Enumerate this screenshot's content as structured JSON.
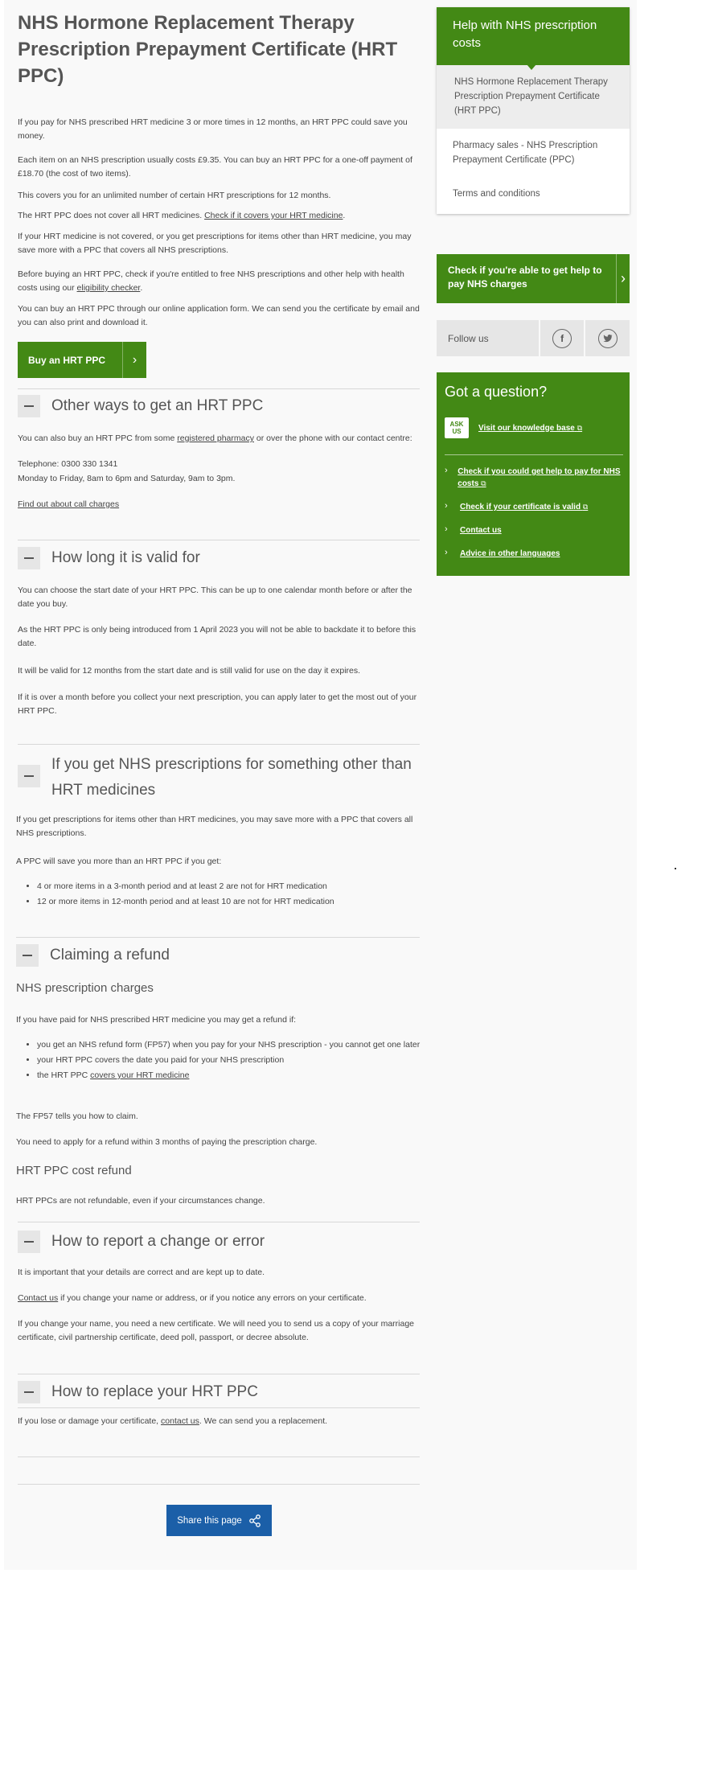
{
  "title": "NHS Hormone Replacement Therapy Prescription Prepayment Certificate (HRT PPC)",
  "intro": [
    "If you pay for NHS prescribed HRT medicine 3 or more times in 12 months, an HRT PPC could save you money.",
    "Each item on an NHS prescription usually costs £9.35. You can buy an HRT PPC for a one-off payment of £18.70 (the cost of two items).",
    "This covers you for an unlimited number of certain HRT prescriptions for 12 months."
  ],
  "covers": {
    "pre": "The HRT PPC does not cover all HRT medicines. ",
    "link": "Check if it covers your HRT medicine",
    "post": "."
  },
  "not_covered": "If your HRT medicine is not covered, or you get prescriptions for items other than HRT medicine, you may save more with a PPC that covers all NHS prescriptions.",
  "before_buying": {
    "pre": "Before buying an HRT PPC, check if you're entitled to free NHS prescriptions and other help with health costs using our ",
    "link": "eligibility checker",
    "post": "."
  },
  "online": "You can buy an HRT PPC through our online application form. We can send you the certificate by email and you can also print and download it.",
  "buy_button": "Buy an HRT PPC",
  "chevron": "›",
  "other_ways": {
    "title": "Other ways to get an HRT PPC",
    "text_pre": "You can also buy an HRT PPC from some ",
    "text_link": "registered pharmacy",
    "text_post": " or over the phone with our contact centre:",
    "telephone": "Telephone: 0300 330 1341",
    "hours": "Monday to Friday, 8am to 6pm and Saturday, 9am to 3pm.",
    "call_charges": "Find out about call charges"
  },
  "valid": {
    "title": "How long it is valid for",
    "p1": "You can choose the start date of your HRT PPC. This can be up to one calendar month before or after the date you buy.",
    "p2": "As the HRT PPC is only being introduced from 1 April 2023 you will not be able to backdate it to before this date.",
    "p3": "It will be valid for 12 months from the start date and is still valid for use on the day it expires.",
    "p4": "If it is over a month before you collect your next prescription, you can apply later to get the most out of your HRT PPC."
  },
  "other_meds": {
    "title": "If you get NHS prescriptions for something other than HRT medicines",
    "p1": "If you get prescriptions for items other than HRT medicines, you may save more with a PPC that covers all NHS prescriptions.",
    "p2": "A PPC will save you more than an HRT PPC if you get:",
    "items": [
      "4 or more items in a 3-month period and at least 2 are not for HRT medication",
      "12 or more items in 12-month period and at least 10 are not for HRT medication"
    ]
  },
  "refund": {
    "title": "Claiming a refund",
    "sub1": "NHS prescription charges",
    "p1": "If you have paid for NHS prescribed HRT medicine you may get a refund if:",
    "item1": "you get an NHS refund form (FP57) when you pay for your NHS prescription - you cannot get one later",
    "item2": "your HRT PPC covers the date you paid for your NHS prescription",
    "item3_pre": "the HRT PPC ",
    "item3_link": "covers your HRT medicine",
    "p2": "The FP57 tells you how to claim.",
    "p3": "You need to apply for a refund within 3 months of paying the prescription charge.",
    "sub2": "HRT PPC cost refund",
    "p4": "HRT PPCs are not refundable, even if your circumstances change."
  },
  "report": {
    "title": "How to report a change or error",
    "p1": "It is important that your details are correct and are kept up to date.",
    "p2_link": "Contact us",
    "p2_post": " if you change your name or address, or if you notice any errors on your certificate.",
    "p3": "If you change your name, you need a new certificate. We will need you to send us a copy of your marriage certificate, civil partnership certificate, deed poll, passport, or decree absolute."
  },
  "replace": {
    "title": "How to replace your HRT PPC",
    "pre": "If you lose or damage your certificate, ",
    "link": "contact us",
    "post": ". We can send you a replacement."
  },
  "share_button": "Share this page",
  "sidebar": {
    "help_title": "Help with NHS prescription costs",
    "items": [
      "NHS Hormone Replacement Therapy Prescription Prepayment Certificate (HRT PPC)",
      "Pharmacy sales - NHS Prescription Prepayment Certificate (PPC)",
      "Terms and conditions"
    ],
    "check_box": "Check if you're able to get help to pay NHS charges",
    "follow_us": "Follow us",
    "facebook": "f",
    "twitter": "t",
    "question_title": "Got a question?",
    "ask_us_badge": "ASK US",
    "knowledge_base": "Visit our knowledge base",
    "links": [
      "Check if you could get help to pay for NHS costs",
      "Check if your certificate is valid",
      "Contact us",
      "Advice in other languages"
    ],
    "external_icon": "⧉"
  }
}
